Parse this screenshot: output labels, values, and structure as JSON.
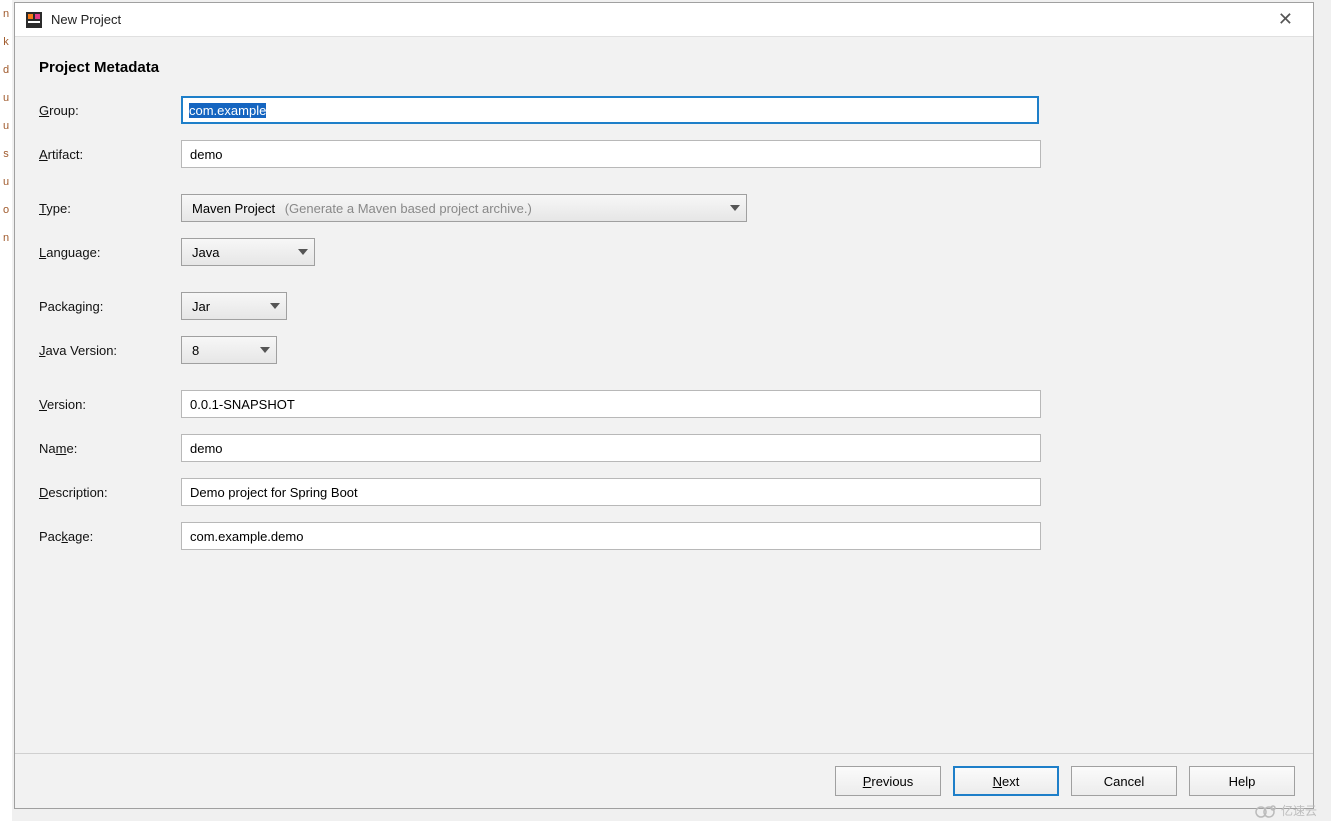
{
  "window": {
    "title": "New Project"
  },
  "heading": "Project Metadata",
  "labels": {
    "group": "roup:",
    "artifact": "rtifact:",
    "type": "ype:",
    "language": "anguage:",
    "packaging": "Packaging:",
    "javaVersion": "ava Version:",
    "version": "ersion:",
    "name": "Na",
    "name2": "e:",
    "description": "escription:",
    "package": "Pac",
    "package2": "age:"
  },
  "fields": {
    "group": "com.example",
    "artifact": "demo",
    "type_value": "Maven Project",
    "type_hint": "(Generate a Maven based project archive.)",
    "language": "Java",
    "packaging": "Jar",
    "javaVersion": "8",
    "version": "0.0.1-SNAPSHOT",
    "name": "demo",
    "description": "Demo project for Spring Boot",
    "package": "com.example.demo"
  },
  "buttons": {
    "previous": "revious",
    "next": "ext",
    "cancel": "Cancel",
    "help": "Help"
  },
  "watermark": "亿速云"
}
